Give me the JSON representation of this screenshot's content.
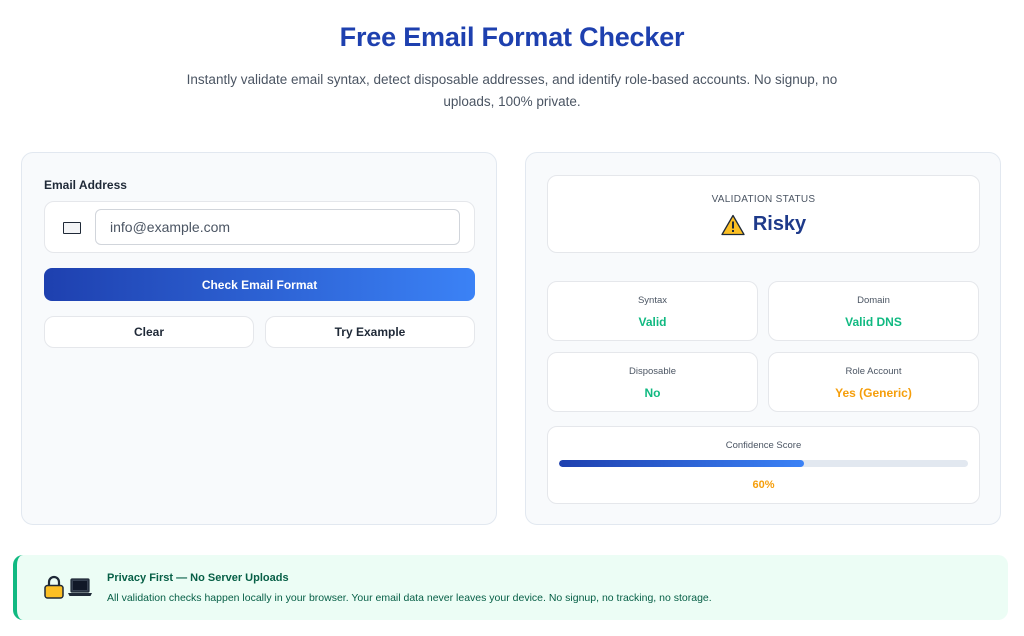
{
  "header": {
    "title": "Free Email Format Checker",
    "subtitle": "Instantly validate email syntax, detect disposable addresses, and identify role-based accounts. No signup, no uploads, 100% private."
  },
  "form": {
    "label": "Email Address",
    "input_value": "",
    "input_placeholder": "info@example.com",
    "check_button": "Check Email Format",
    "clear_button": "Clear",
    "example_button": "Try Example"
  },
  "result": {
    "status_label": "VALIDATION STATUS",
    "status_value": "Risky",
    "status_icon": "warning-icon",
    "checks": [
      {
        "label": "Syntax",
        "value": "Valid",
        "color": "#10b981"
      },
      {
        "label": "Domain",
        "value": "Valid DNS",
        "color": "#10b981"
      },
      {
        "label": "Disposable",
        "value": "No",
        "color": "#10b981"
      },
      {
        "label": "Role Account",
        "value": "Yes (Generic)",
        "color": "#f59e0b"
      }
    ],
    "confidence_label": "Confidence Score",
    "confidence_value": "60%",
    "confidence_fraction": 0.6,
    "confidence_color": "#f59e0b"
  },
  "privacy": {
    "title": "Privacy First — No Server Uploads",
    "text": "All validation checks happen locally in your browser. Your email data never leaves your device. No signup, no tracking, no storage."
  },
  "colors": {
    "brand": "#1e40af",
    "accent": "#3b82f6",
    "success": "#10b981",
    "warning": "#f59e0b"
  }
}
